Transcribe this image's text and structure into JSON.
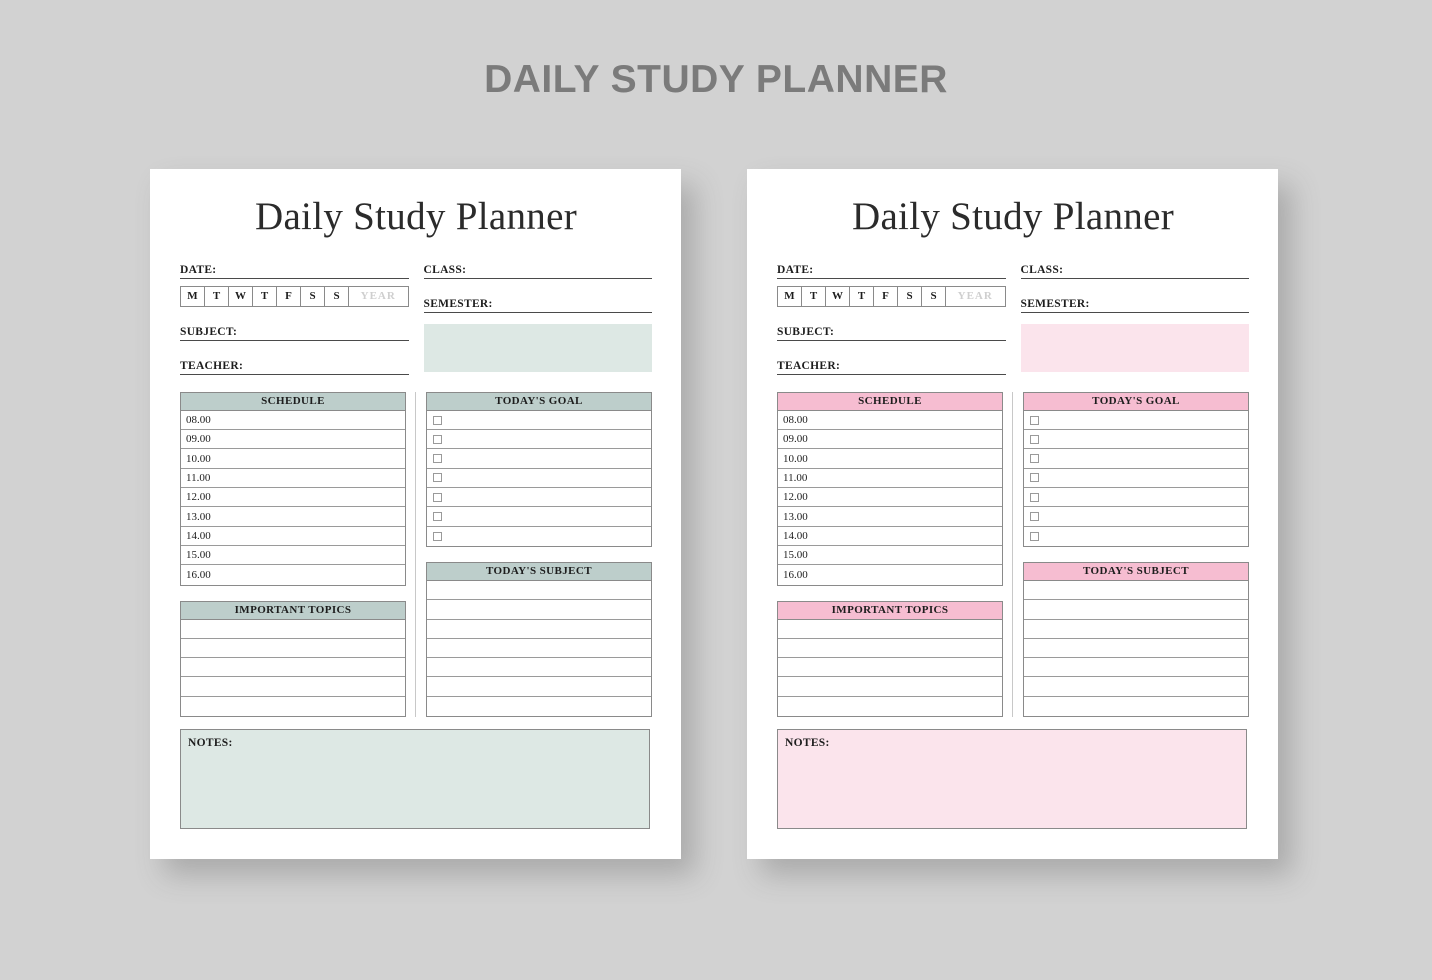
{
  "poster": {
    "title": "DAILY STUDY PLANNER",
    "background_color": "#d2d2d2",
    "title_color": "#7b7b7b"
  },
  "sheets": [
    {
      "id": "teal",
      "title": "Daily Study Planner",
      "accent_header_color": "#bdcecb",
      "accent_tint_color": "#dde8e4",
      "fields": {
        "date_label": "DATE:",
        "class_label": "CLASS:",
        "semester_label": "SEMESTER:",
        "subject_label": "SUBJECT:",
        "teacher_label": "TEACHER:"
      },
      "days": [
        "M",
        "T",
        "W",
        "T",
        "F",
        "S",
        "S"
      ],
      "year_label": "YEAR",
      "schedule": {
        "header": "SCHEDULE",
        "times": [
          "08.00",
          "09.00",
          "10.00",
          "11.00",
          "12.00",
          "13.00",
          "14.00",
          "15.00",
          "16.00"
        ]
      },
      "goal": {
        "header": "TODAY'S GOAL",
        "row_count": 7
      },
      "today_subject": {
        "header": "TODAY'S SUBJECT",
        "row_count": 7
      },
      "important_topics": {
        "header": "IMPORTANT TOPICS",
        "row_count": 5
      },
      "notes": {
        "label": "NOTES:"
      }
    },
    {
      "id": "pink",
      "title": "Daily Study Planner",
      "accent_header_color": "#f6bdd1",
      "accent_tint_color": "#fbe4ec",
      "fields": {
        "date_label": "DATE:",
        "class_label": "CLASS:",
        "semester_label": "SEMESTER:",
        "subject_label": "SUBJECT:",
        "teacher_label": "TEACHER:"
      },
      "days": [
        "M",
        "T",
        "W",
        "T",
        "F",
        "S",
        "S"
      ],
      "year_label": "YEAR",
      "schedule": {
        "header": "SCHEDULE",
        "times": [
          "08.00",
          "09.00",
          "10.00",
          "11.00",
          "12.00",
          "13.00",
          "14.00",
          "15.00",
          "16.00"
        ]
      },
      "goal": {
        "header": "TODAY'S GOAL",
        "row_count": 7
      },
      "today_subject": {
        "header": "TODAY'S SUBJECT",
        "row_count": 7
      },
      "important_topics": {
        "header": "IMPORTANT TOPICS",
        "row_count": 5
      },
      "notes": {
        "label": "NOTES:"
      }
    }
  ]
}
